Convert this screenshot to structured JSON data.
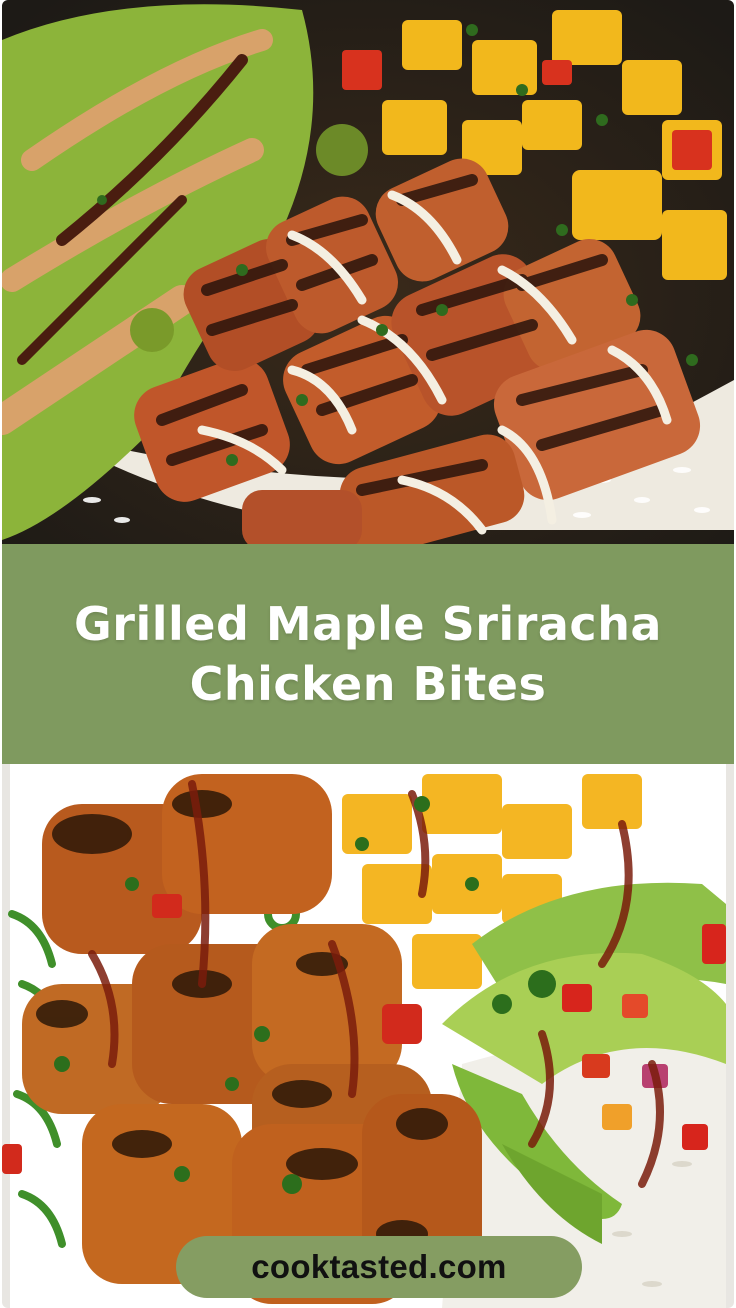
{
  "title": {
    "line1": "Grilled Maple Sriracha",
    "line2": "Chicken Bites"
  },
  "site": {
    "label": "cooktasted.com"
  },
  "photos": {
    "top": "grilled chicken bowl with avocado, mango and rice",
    "bottom": "glazed chicken bites with avocado, mango salsa and rice"
  },
  "colors": {
    "band": "#7f9a5f",
    "pill": "#859d62",
    "title_text": "#ffffff",
    "site_text": "#111111"
  }
}
